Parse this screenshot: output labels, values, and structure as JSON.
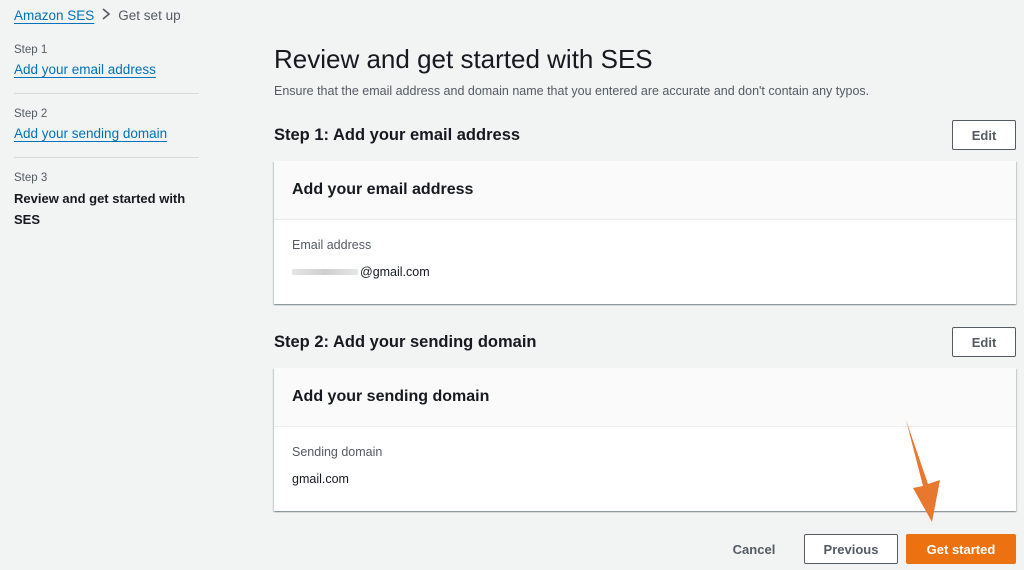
{
  "breadcrumb": {
    "parent": "Amazon SES",
    "separator_icon": "chevron-right-icon",
    "current": "Get set up"
  },
  "steps": [
    {
      "number": "Step 1",
      "label": "Add your email address",
      "state": "completed"
    },
    {
      "number": "Step 2",
      "label": "Add your sending domain",
      "state": "completed"
    },
    {
      "number": "Step 3",
      "label": "Review and get started with SES",
      "state": "current"
    }
  ],
  "main": {
    "title": "Review and get started with SES",
    "description": "Ensure that the email address and domain name that you entered are accurate and don't contain any typos.",
    "sections": [
      {
        "heading": "Step 1: Add your email address",
        "edit_label": "Edit",
        "card_title": "Add your email address",
        "field_label": "Email address",
        "field_value": "@gmail.com",
        "value_redacted": true
      },
      {
        "heading": "Step 2: Add your sending domain",
        "edit_label": "Edit",
        "card_title": "Add your sending domain",
        "field_label": "Sending domain",
        "field_value": "gmail.com",
        "value_redacted": false
      }
    ]
  },
  "footer": {
    "cancel_label": "Cancel",
    "previous_label": "Previous",
    "primary_label": "Get started"
  },
  "colors": {
    "link": "#0073bb",
    "primary_button": "#ec7211",
    "annotation_arrow": "#e8782e",
    "background": "#f2f3f3"
  }
}
